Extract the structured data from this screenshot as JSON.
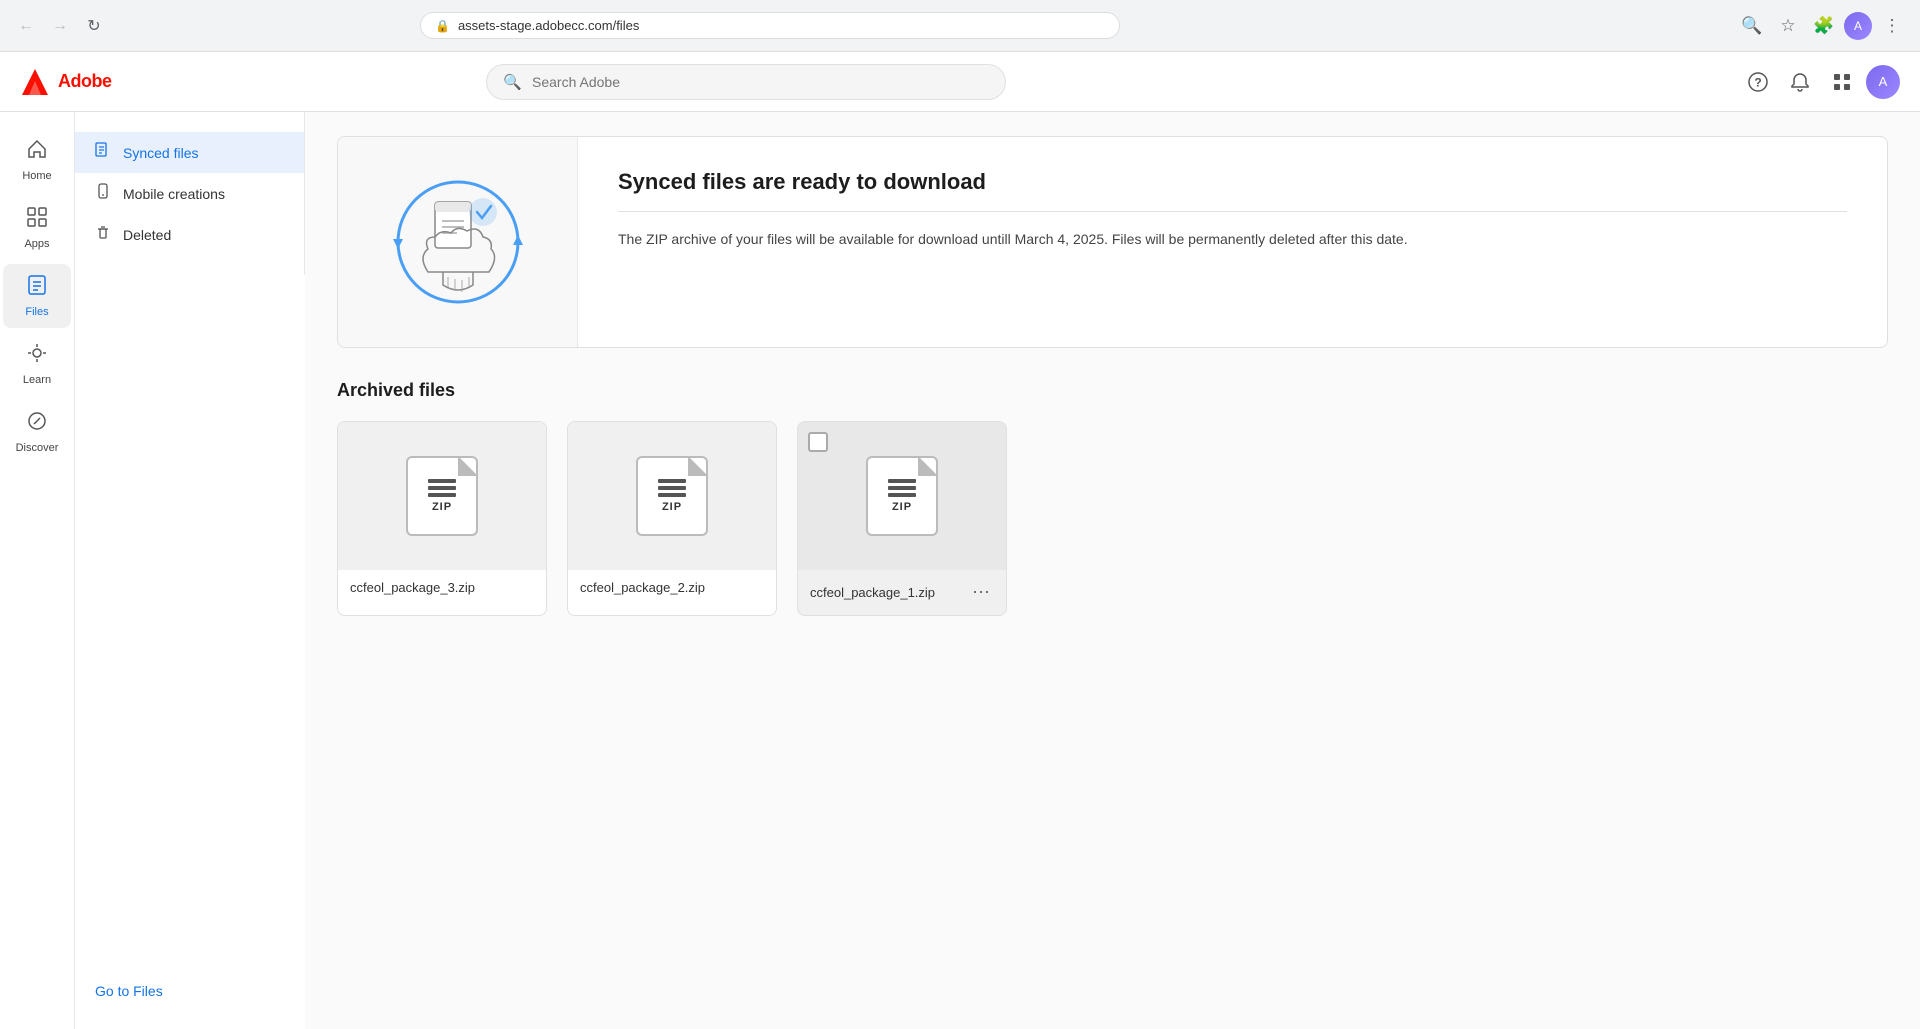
{
  "browser": {
    "url": "assets-stage.adobecc.com/files",
    "back_btn": "←",
    "forward_btn": "→",
    "refresh_btn": "↻",
    "search_icon": "🔍",
    "bookmark_icon": "☆",
    "extensions_icon": "🧩",
    "menu_icon": "⋮"
  },
  "topnav": {
    "logo_text": "Adobe",
    "search_placeholder": "Search Adobe",
    "help_icon": "?",
    "notifications_icon": "🔔",
    "apps_grid_icon": "⊞",
    "profile_initial": "A"
  },
  "sidebar": {
    "items": [
      {
        "id": "home",
        "label": "Home",
        "icon": "⌂"
      },
      {
        "id": "apps",
        "label": "Apps",
        "icon": "⊞"
      },
      {
        "id": "files",
        "label": "Files",
        "icon": "📄",
        "active": true
      },
      {
        "id": "learn",
        "label": "Learn",
        "icon": "💡"
      },
      {
        "id": "discover",
        "label": "Discover",
        "icon": "🔭"
      }
    ]
  },
  "sub_sidebar": {
    "items": [
      {
        "id": "synced-files",
        "label": "Synced files",
        "icon": "📋",
        "active": true
      },
      {
        "id": "mobile-creations",
        "label": "Mobile creations",
        "icon": "📱"
      },
      {
        "id": "deleted",
        "label": "Deleted",
        "icon": "🗑"
      }
    ],
    "go_to_files": "Go to Files"
  },
  "banner": {
    "title": "Synced files are ready to download",
    "description": "The ZIP archive of your files will be available for download untill March 4, 2025. Files will be permanently deleted after this date."
  },
  "archived_files": {
    "section_title": "Archived files",
    "files": [
      {
        "id": "file-1",
        "name": "ccfeol_package_3.zip",
        "has_checkbox": false,
        "has_menu": false
      },
      {
        "id": "file-2",
        "name": "ccfeol_package_2.zip",
        "has_checkbox": false,
        "has_menu": false
      },
      {
        "id": "file-3",
        "name": "ccfeol_package_1.zip",
        "has_checkbox": true,
        "has_menu": true
      }
    ],
    "zip_label": "ZIP",
    "menu_dots": "⋯"
  }
}
